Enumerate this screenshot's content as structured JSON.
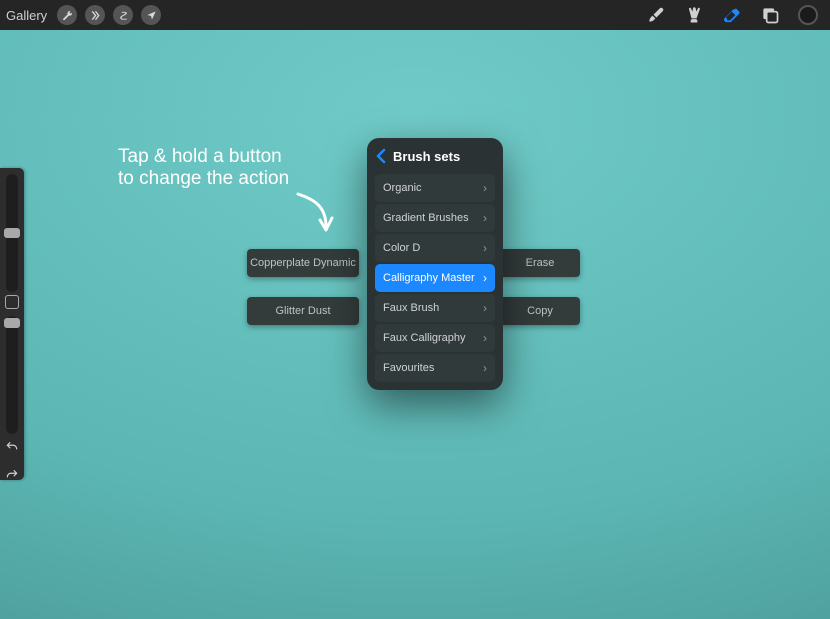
{
  "topbar": {
    "gallery": "Gallery"
  },
  "sidebar": {
    "slider1": 50,
    "slider2": 2
  },
  "annotation": {
    "line1": "Tap & hold a button",
    "line2": "to change the action"
  },
  "quick_buttons": {
    "btn1": "Copperplate Dynamic",
    "btn2": "Glitter Dust",
    "btn3": "Erase",
    "btn4": "Copy"
  },
  "popover": {
    "title": "Brush sets",
    "items": [
      {
        "label": "Organic",
        "arrow": true,
        "selected": false
      },
      {
        "label": "Gradient Brushes",
        "arrow": true,
        "selected": false
      },
      {
        "label": "Color D",
        "arrow": true,
        "selected": false
      },
      {
        "label": "Calligraphy Master",
        "arrow": true,
        "selected": true
      },
      {
        "label": "Faux Brush",
        "arrow": true,
        "selected": false
      },
      {
        "label": "Faux Calligraphy",
        "arrow": true,
        "selected": false
      },
      {
        "label": "Favourites",
        "arrow": true,
        "selected": false
      }
    ]
  },
  "colors": {
    "accent": "#1b88ff",
    "canvas": "#60bebb",
    "panel": "#2b3233"
  }
}
